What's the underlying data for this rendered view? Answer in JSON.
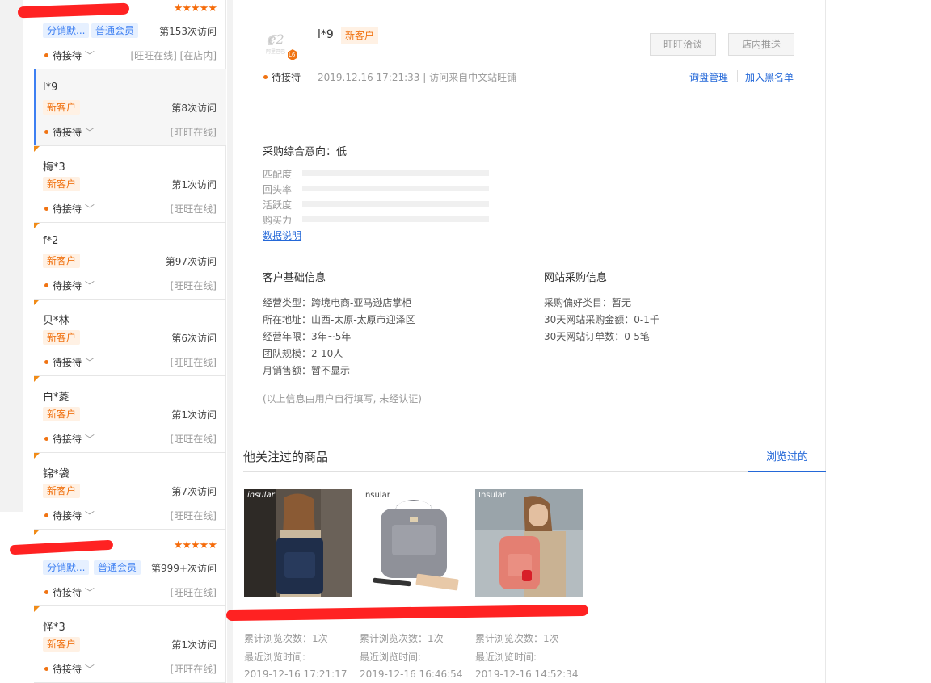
{
  "customers": [
    {
      "name": "",
      "tags": [
        "分销默...",
        "普通会员"
      ],
      "visits": "第153次访问",
      "status": "待接待",
      "online": "[旺旺在线] [在店内]",
      "stars": "★★★★★"
    },
    {
      "name": "l*9",
      "tags": [
        "新客户"
      ],
      "visits": "第8次访问",
      "status": "待接待",
      "online": "[旺旺在线]"
    },
    {
      "name": "梅*3",
      "tags": [
        "新客户"
      ],
      "visits": "第1次访问",
      "status": "待接待",
      "online": "[旺旺在线]"
    },
    {
      "name": "f*2",
      "tags": [
        "新客户"
      ],
      "visits": "第97次访问",
      "status": "待接待",
      "online": "[旺旺在线]"
    },
    {
      "name": "贝*林",
      "tags": [
        "新客户"
      ],
      "visits": "第6次访问",
      "status": "待接待",
      "online": "[旺旺在线]"
    },
    {
      "name": "白*菱",
      "tags": [
        "新客户"
      ],
      "visits": "第1次访问",
      "status": "待接待",
      "online": "[旺旺在线]"
    },
    {
      "name": "锦*袋",
      "tags": [
        "新客户"
      ],
      "visits": "第7次访问",
      "status": "待接待",
      "online": "[旺旺在线]"
    },
    {
      "name": "",
      "tags": [
        "分销默...",
        "普通会员"
      ],
      "visits": "第999+次访问",
      "status": "待接待",
      "online": "[旺旺在线]",
      "stars": "★★★★★"
    },
    {
      "name": "怪*3",
      "tags": [
        "新客户"
      ],
      "visits": "第1次访问",
      "status": "待接待",
      "online": "[旺旺在线]"
    }
  ],
  "header": {
    "username": "l*9",
    "tag": "新客户",
    "btn_chat": "旺旺洽谈",
    "btn_push": "店内推送",
    "status": "待接待",
    "time_source": "2019.12.16 17:21:33 | 访问来自中文站旺铺",
    "link_inquiry": "询盘管理",
    "link_blacklist": "加入黑名单",
    "logo_badge": "L6"
  },
  "intent": {
    "title": "采购综合意向：低",
    "metrics": [
      "匹配度",
      "回头率",
      "活跃度",
      "购买力"
    ],
    "data_link": "数据说明"
  },
  "basic_info": {
    "title": "客户基础信息",
    "rows": [
      "经营类型：跨境电商-亚马逊店掌柜",
      "所在地址：山西-太原-太原市迎泽区",
      "经营年限：3年~5年",
      "团队规模：2-10人",
      "月销售额：暂不显示"
    ],
    "note": "(以上信息由用户自行填写, 未经认证)"
  },
  "site_info": {
    "title": "网站采购信息",
    "rows": [
      "采购偏好类目：暂无",
      "30天网站采购金额：0-1千",
      "30天网站订单数：0-5笔"
    ]
  },
  "products": {
    "title": "他关注过的商品",
    "tab": "浏览过的",
    "items": [
      {
        "brand": "insular",
        "views": "累计浏览次数：1次",
        "recent_label": "最近浏览时间:",
        "time": "2019-12-16 17:21:17"
      },
      {
        "brand": "Insular",
        "views": "累计浏览次数：1次",
        "recent_label": "最近浏览时间:",
        "time": "2019-12-16 16:46:54"
      },
      {
        "brand": "Insular",
        "views": "累计浏览次数：1次",
        "recent_label": "最近浏览时间:",
        "time": "2019-12-16 14:52:34"
      }
    ]
  },
  "colors": {
    "accent": "#2468d8",
    "orange": "#f07312",
    "active_bar": "#3d7ff2"
  }
}
